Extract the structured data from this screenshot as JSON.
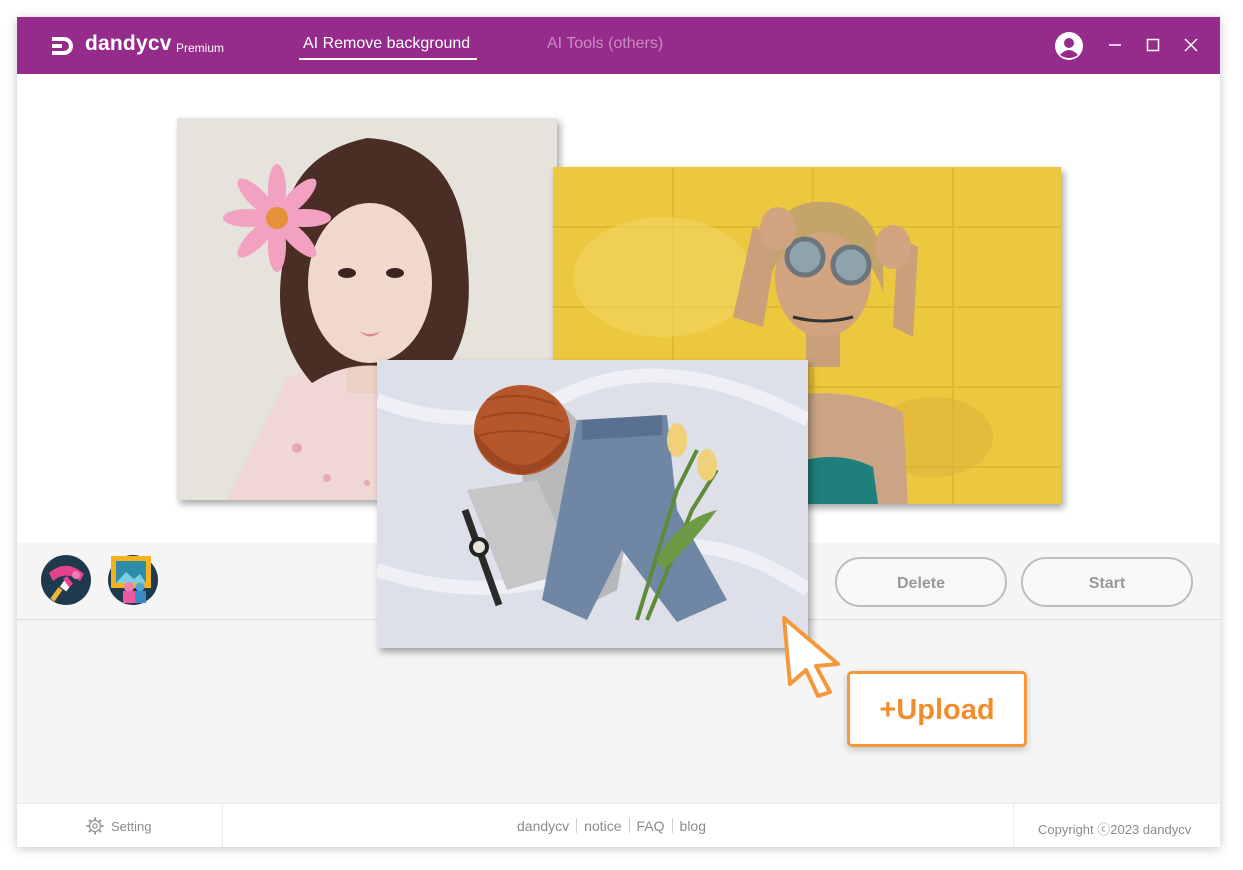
{
  "app": {
    "brand": "dandycv",
    "edition": "Premium"
  },
  "tabs": [
    {
      "label": "AI Remove background",
      "active": true
    },
    {
      "label": "AI Tools (others)",
      "active": false
    }
  ],
  "toolbar": {
    "delete_label": "Delete",
    "start_label": "Start"
  },
  "upload": {
    "label": "+Upload"
  },
  "footer": {
    "setting_label": "Setting",
    "links": [
      "dandycv",
      "notice",
      "FAQ",
      "blog"
    ],
    "copyright": "Copyright ⓒ2023 dandycv"
  },
  "colors": {
    "titlebar": "#952b8a",
    "accent_upload": "#f28d2d"
  },
  "icons": {
    "logo": "dandycv-logo-icon",
    "user": "user-avatar-icon",
    "minimize": "minimize-icon",
    "maximize": "maximize-icon",
    "close": "close-icon",
    "gear": "gear-icon",
    "cursor": "cursor-arrow-icon"
  }
}
